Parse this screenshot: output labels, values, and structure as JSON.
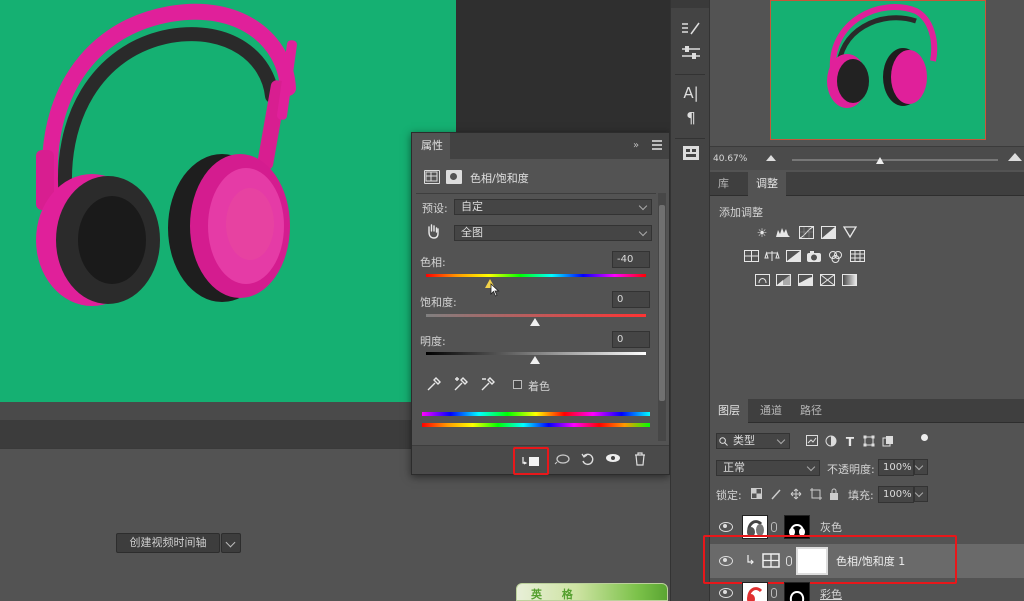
{
  "properties_panel": {
    "tab_label": "属性",
    "collapse_glyph": "»",
    "adjustment_title": "色相/饱和度",
    "preset_label": "预设:",
    "preset_value": "自定",
    "channel_value": "全图",
    "hue_label": "色相:",
    "hue_value": "-40",
    "saturation_label": "饱和度:",
    "saturation_value": "0",
    "lightness_label": "明度:",
    "lightness_value": "0",
    "colorize_label": "着色"
  },
  "timeline": {
    "create_video_label": "创建视频时间轴"
  },
  "thumbnail": {
    "text": "英 格"
  },
  "navigator": {
    "zoom_value": "40.67%"
  },
  "adjustments_panel": {
    "tabs": [
      "库",
      "调整"
    ],
    "add_label": "添加调整"
  },
  "layers_panel": {
    "tabs": [
      "图层",
      "通道",
      "路径"
    ],
    "filter_label": "类型",
    "blend_mode": "正常",
    "opacity_label": "不透明度:",
    "opacity_value": "100%",
    "lock_label": "锁定:",
    "fill_label": "填充:",
    "fill_value": "100%",
    "layers": [
      {
        "name": "灰色"
      },
      {
        "name": "色相/饱和度 1"
      },
      {
        "name": "彩色"
      }
    ]
  },
  "colors": {
    "canvas_green": "#15b072",
    "headphone_pink": "#e0209a",
    "highlight_red": "#e8171a"
  }
}
